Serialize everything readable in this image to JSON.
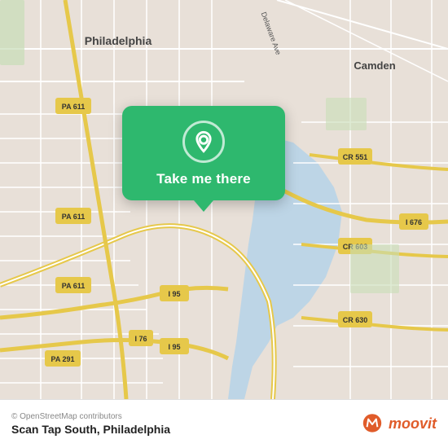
{
  "map": {
    "attribution": "© OpenStreetMap contributors",
    "background_color": "#e8e0d8"
  },
  "popup": {
    "label": "Take me there",
    "icon": "location-pin"
  },
  "bottom_bar": {
    "location_name": "Scan Tap South, Philadelphia",
    "attribution": "© OpenStreetMap contributors",
    "moovit_logo_text": "moovit"
  }
}
